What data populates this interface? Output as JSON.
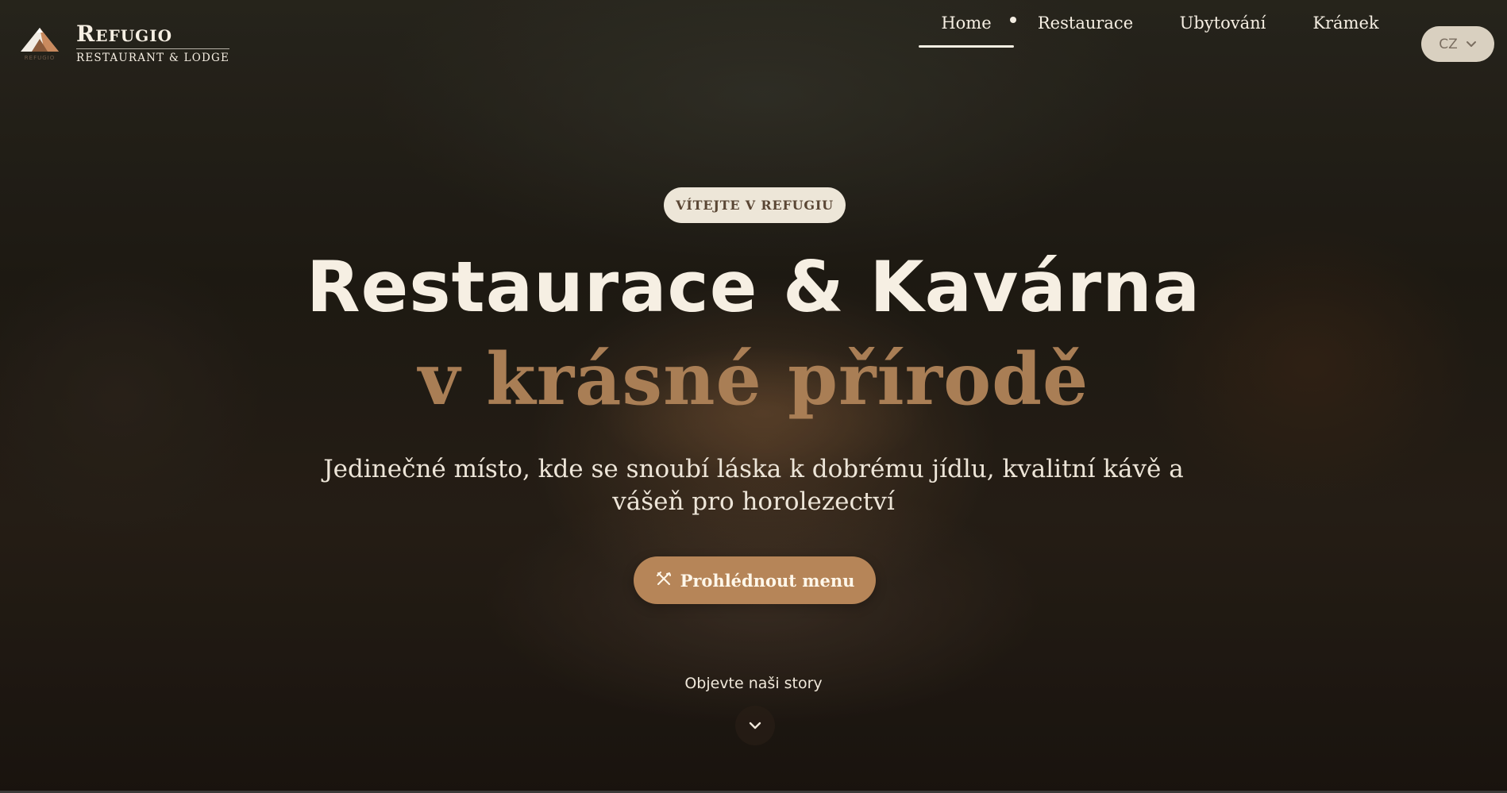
{
  "brand": {
    "name": "Refugio",
    "tagline": "RESTAURANT & LODGE",
    "mark_text": "REFUGIO"
  },
  "nav": {
    "items": [
      {
        "label": "Home",
        "active": true
      },
      {
        "label": "Restaurace",
        "active": false
      },
      {
        "label": "Ubytování",
        "active": false
      },
      {
        "label": "Krámek",
        "active": false
      }
    ],
    "language": "CZ"
  },
  "hero": {
    "badge": "VÍTEJTE V REFUGIU",
    "title_line1": "Restaurace & Kavárna",
    "title_line2": "v krásné přírodě",
    "subtitle": "Jedinečné místo, kde se snoubí láska k dobrému jídlu, kvalitní kávě a vášeň pro horolezectví",
    "cta_label": "Prohlédnout menu",
    "discover_label": "Objevte naši story"
  },
  "icons": {
    "cta": "utensils-icon",
    "scroll": "chevron-down-icon",
    "language": "chevron-down-icon",
    "logo": "mountain-logo-icon"
  },
  "colors": {
    "accent": "#b68558",
    "title_accent": "#a97e55",
    "text_light": "#f6efe3",
    "badge_bg": "#ede6d8",
    "lang_bg": "#d9d0c0"
  }
}
